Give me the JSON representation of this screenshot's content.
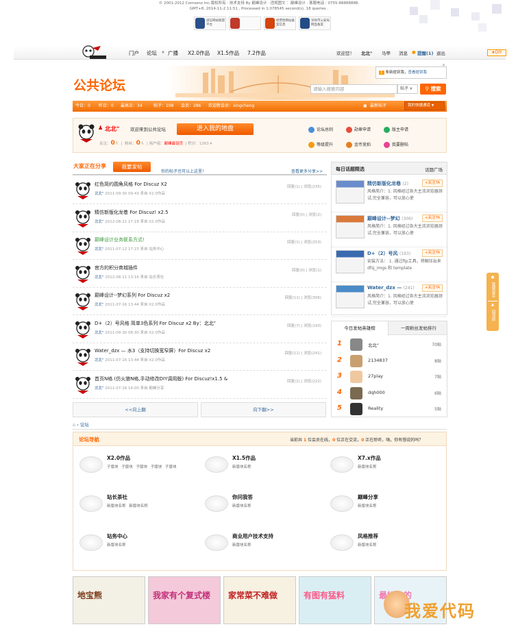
{
  "top_info": {
    "line1": "© 2001-2012 Comsenz Inc.版权所有 · 技术支持 By 巅峰设计 · 违规图文 ：巅峰设计 · 客服电话 : 0755-88888888.",
    "line2": "GMT+8, 2014-11-2 11:51 , Processed in 1.078545 second(s), 18 queries ."
  },
  "badges": [
    {
      "text": "诚信网站联盟平台",
      "color": "#2b4f8a"
    },
    {
      "text": "",
      "color": "#c0392b"
    },
    {
      "text": "经营性网站备案信息",
      "color": "#d4440c"
    },
    {
      "text": "深圳市公安局网监备案",
      "color": "#234b85"
    }
  ],
  "nav": {
    "items": [
      "门户",
      "论坛",
      "广播",
      "X2.0作品",
      "X1.5作品",
      "7.2作品"
    ],
    "right": [
      "欢迎您！",
      "北北\"",
      "马甲",
      "消息",
      "提醒(1)",
      "退出"
    ],
    "diy": "DIY"
  },
  "notice": {
    "count": "1",
    "text": "条新提到我，",
    "link": "查看提到我"
  },
  "forum_title": "公共论坛",
  "search": {
    "placeholder": "请输入搜索内容",
    "scope": "帖子",
    "button": "搜索"
  },
  "stats": {
    "today": "今日：0",
    "yesterday": "昨日：0",
    "max": "最高日：34",
    "posts": "帖子：198",
    "members": "会员：286",
    "newest": "欢迎新会员：xingcheng",
    "latest_link": "最新帖子",
    "quick": "我的快捷通道"
  },
  "user": {
    "name": "北北\"",
    "welcome": "欢迎来到公共论坛",
    "enter": "进入我的地盘",
    "follow_label": "关注：",
    "follow": "0",
    "follow_unit": "人",
    "fans_label": "粉丝：",
    "fans": "0",
    "fans_unit": "人",
    "group_label": "用户组：",
    "group": "巅峰最设页",
    "credit_label": "积分：",
    "credit": "1263"
  },
  "quick_links": [
    {
      "label": "论坛总则",
      "color": "#4a90d9"
    },
    {
      "label": "勋章申请",
      "color": "#e74c3c"
    },
    {
      "label": "版主申请",
      "color": "#27ae60"
    },
    {
      "label": "等级提升",
      "color": "#f39c12"
    },
    {
      "label": "金币竞拍",
      "color": "#e67e22"
    },
    {
      "label": "我要删帖",
      "color": "#e84393"
    }
  ],
  "share": {
    "title": "大家正在分享",
    "post_button": "我要发帖",
    "hint": "你的帖子也可以上这里！",
    "more": "查看更多分享>>"
  },
  "posts": [
    {
      "title": "红色简约圆角风格 For Discuz X2",
      "author": "北北\"",
      "meta": "2011-09-30 09:43 来自 X2.0作品",
      "stats": "回复(1) | 浏览(235)",
      "color": "#222"
    },
    {
      "title": "精仿新版化龙巷 For Discuz! x2.5",
      "author": "北北\"",
      "meta": "2012-08-21 17:18 来自 X2.0作品",
      "stats": "回复(0) | 浏览(2)",
      "color": "#222"
    },
    {
      "title": "巅峰设计业务联系方式!",
      "author": "北北\"",
      "meta": "2011-07-12 17:23 来自 站务中心",
      "stats": "回复(1) | 浏览(253)",
      "color": "#3a9a3a"
    },
    {
      "title": "官方的积分商城插件",
      "author": "北北\"",
      "meta": "2012-08-11 13:16 来自 站长茶社",
      "stats": "回复(0) | 浏览(1)",
      "color": "#222"
    },
    {
      "title": "巅峰设计--梦幻系列 For Discuz x2",
      "author": "北北\"",
      "meta": "2011-07-16 13:44 来自 X2.0作品",
      "stats": "回复(11) | 浏览(306)",
      "color": "#222"
    },
    {
      "title": "D+（2）号风格 简单3色系列 For Discuz x2 By：北北\"",
      "author": "北北\"",
      "meta": "2011-09-30 08:30 来自 X2.0作品",
      "stats": "回复(7) | 浏览(193)",
      "color": "#222"
    },
    {
      "title": "Water_dzx — 水3（支持切换宽窄屏）For Discuz x2",
      "author": "北北\"",
      "meta": "2011-07-16 13:44 来自 X2.0作品",
      "stats": "回复(11) | 浏览(241)",
      "color": "#222"
    },
    {
      "title": "首页N格 (仿火狼N格,手动修改DIY调用版) For Discuz!x1.5 &",
      "author": "北北\"",
      "meta": "2011-07-16 14:00 来自 巅峰分享",
      "stats": "回复(2) | 浏览(222)",
      "color": "#222"
    }
  ],
  "pager": {
    "prev": "<<向上翻",
    "next": "向下翻>>"
  },
  "topics": {
    "title": "每日话题精选",
    "square": "话题广场",
    "items": [
      {
        "title": "精仿新版化龙巷",
        "count": "(2)",
        "desc": "风格简介：1. 风格经过各大主流浏览器测试,完全兼容，可以放心使",
        "follow": "+关注TA",
        "color": "#6a8ccc"
      },
      {
        "title": "巅峰设计--梦幻",
        "count": "(306)",
        "desc": "风格简介：1. 风格经过各大主流浏览器测试,完全兼容，可以放心使",
        "follow": "+关注TA",
        "color": "#d97a3a"
      },
      {
        "title": "D+（2）号风",
        "count": "(193)",
        "desc": "安装方法： 1. 通过ftp工具，将解压出来 dfsj_imgs 和 template",
        "follow": "+关注TA",
        "color": "#3a6ab0"
      },
      {
        "title": "Water_dzx —",
        "count": "(241)",
        "desc": "风格简介：1. 风格经过各大主流浏览器测试,完全兼容，可以放心使",
        "follow": "+关注TA",
        "color": "#4a8cc8"
      }
    ]
  },
  "rank": {
    "tab1": "今日发帖英雄榜",
    "tab2": "一周粉丝发帖排行",
    "items": [
      {
        "no": "1",
        "name": "北北\"",
        "count": "70贴"
      },
      {
        "no": "2",
        "name": "2134837",
        "count": "8贴"
      },
      {
        "no": "3",
        "name": "27play",
        "count": "7贴"
      },
      {
        "no": "4",
        "name": "dqh000",
        "count": "6贴"
      },
      {
        "no": "5",
        "name": "Reality",
        "count": "5贴"
      }
    ]
  },
  "side_tool": {
    "top": "我要留言",
    "bottom": "回顶部"
  },
  "breadcrumb": "论坛",
  "forum_nav": {
    "title": "论坛导航",
    "online_pre": "当前共",
    "online_1": "1",
    "online_mid1": "位会员在线，",
    "online_2": "0",
    "online_mid2": "位正在交流，",
    "online_3": "0",
    "online_end": "正在聆听，嗨，你有想说的吗？",
    "boards": [
      {
        "name": "X2.0作品",
        "subs": "子版块 子版块 子版块 子版块 子版块"
      },
      {
        "name": "X1.5作品",
        "subs": "新版块名称"
      },
      {
        "name": "X7.x作品",
        "subs": "新版块名称"
      },
      {
        "name": "站长茶社",
        "subs": "新版块名称 新版块名称"
      },
      {
        "name": "你问我答",
        "subs": "新版块名称"
      },
      {
        "name": "巅峰分享",
        "subs": "新版块名称"
      },
      {
        "name": "站务中心",
        "subs": "新版块名称"
      },
      {
        "name": "商业用户技术支持",
        "subs": "新版块名称"
      },
      {
        "name": "风格推荐",
        "subs": "新版块名称"
      }
    ]
  },
  "ads": [
    {
      "text": "地宝熊",
      "bg": "#f3f0e6",
      "fg": "#7a3a1a"
    },
    {
      "text": "我家有个复式楼",
      "bg": "#f4c9d9",
      "fg": "#c1307a"
    },
    {
      "text": "家常菜不难做",
      "bg": "#f7f1e2",
      "fg": "#c02020"
    },
    {
      "text": "有图有猛料",
      "bg": "#d9eef3",
      "fg": "#ff5a8a"
    },
    {
      "text": "最好吃的",
      "bg": "#e8f3f8",
      "fg": "#f07ab0"
    }
  ],
  "watermark": "我爱代码"
}
